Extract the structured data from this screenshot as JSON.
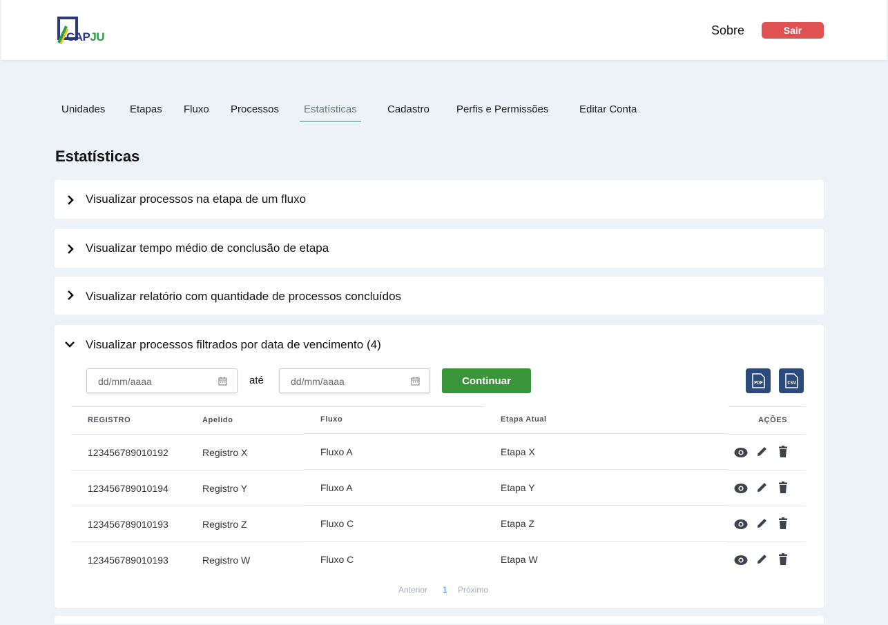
{
  "header": {
    "logo_cap": "CAP",
    "logo_ju": "JU",
    "about_label": "Sobre",
    "logout_label": "Sair"
  },
  "nav": {
    "items": [
      "Unidades",
      "Etapas",
      "Fluxo",
      "Processos",
      "Estatísticas",
      "Cadastro",
      "Perfis e Permissões",
      "Editar Conta"
    ],
    "active": "Estatísticas"
  },
  "page": {
    "title": "Estatísticas"
  },
  "accordions": [
    {
      "title": "Visualizar processos na etapa de um fluxo",
      "expanded": false
    },
    {
      "title": "Visualizar tempo médio de conclusão de etapa",
      "expanded": false
    },
    {
      "title": "Visualizar relatório com quantidade de processos concluídos",
      "expanded": false
    },
    {
      "title": "Visualizar processos filtrados por data de vencimento (4)",
      "expanded": true
    }
  ],
  "filter": {
    "start_placeholder": "dd/mm/aaaa",
    "end_placeholder": "dd/mm/aaaa",
    "separator": "até",
    "submit_label": "Continuar",
    "export_pdf": "PDF",
    "export_csv": "CSV"
  },
  "table": {
    "columns": [
      "REGISTRO",
      "Apelido",
      "Fluxo",
      "Etapa Atual",
      "AÇÕES"
    ],
    "rows": [
      {
        "registro": "123456789010192",
        "apelido": "Registro X",
        "fluxo": "Fluxo A",
        "etapa": "Etapa X"
      },
      {
        "registro": "123456789010194",
        "apelido": "Registro Y",
        "fluxo": "Fluxo A",
        "etapa": "Etapa Y"
      },
      {
        "registro": "123456789010193",
        "apelido": "Registro Z",
        "fluxo": "Fluxo C",
        "etapa": "Etapa Z"
      },
      {
        "registro": "123456789010193",
        "apelido": "Registro W",
        "fluxo": "Fluxo C",
        "etapa": "Etapa W"
      }
    ],
    "pagination": {
      "prev": "Anterior",
      "current": "1",
      "next": "Próximo"
    }
  },
  "colors": {
    "logout": "#e05151",
    "submit": "#3a943a",
    "export": "#2c4a7a",
    "active_tab_underline": "#8fbfae"
  }
}
